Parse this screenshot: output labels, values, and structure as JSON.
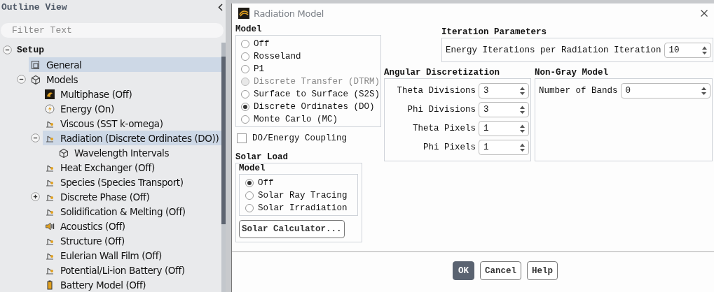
{
  "outline": {
    "title": "Outline View",
    "filter": {
      "placeholder": "Filter Text"
    },
    "tree": [
      {
        "label": "Setup",
        "bold": true,
        "expanded": true,
        "selected": false,
        "children": [
          {
            "label": "General",
            "selected": true
          },
          {
            "label": "Models",
            "expanded": true,
            "selected": false,
            "children": [
              {
                "label": "Multiphase (Off)",
                "selected": false
              },
              {
                "label": "Energy (On)",
                "selected": false
              },
              {
                "label": "Viscous (SST k-omega)",
                "selected": false
              },
              {
                "label": "Radiation (Discrete Ordinates (DO))",
                "expanded": true,
                "selected": true,
                "children": [
                  {
                    "label": "Wavelength Intervals",
                    "selected": false
                  }
                ]
              },
              {
                "label": "Heat Exchanger (Off)",
                "selected": false
              },
              {
                "label": "Species (Species Transport)",
                "selected": false
              },
              {
                "label": "Discrete Phase (Off)",
                "expanded": false,
                "selected": false
              },
              {
                "label": "Solidification & Melting (Off)",
                "selected": false
              },
              {
                "label": "Acoustics (Off)",
                "selected": false
              },
              {
                "label": "Structure (Off)",
                "selected": false
              },
              {
                "label": "Eulerian Wall Film (Off)",
                "selected": false
              },
              {
                "label": "Potential/Li-ion Battery (Off)",
                "selected": false
              },
              {
                "label": "Battery Model (Off)",
                "selected": false
              }
            ]
          }
        ]
      }
    ]
  },
  "dialog": {
    "title": "Radiation Model",
    "model": {
      "title": "Model",
      "options": [
        {
          "label": "Off",
          "selected": false,
          "disabled": false
        },
        {
          "label": "Rosseland",
          "selected": false,
          "disabled": false
        },
        {
          "label": "P1",
          "selected": false,
          "disabled": false
        },
        {
          "label": "Discrete Transfer (DTRM)",
          "selected": false,
          "disabled": true
        },
        {
          "label": "Surface to Surface (S2S)",
          "selected": false,
          "disabled": false
        },
        {
          "label": "Discrete Ordinates (DO)",
          "selected": true,
          "disabled": false
        },
        {
          "label": "Monte Carlo (MC)",
          "selected": false,
          "disabled": false
        }
      ]
    },
    "coupling": {
      "label": "DO/Energy Coupling",
      "checked": false
    },
    "iteration": {
      "title": "Iteration Parameters",
      "fields": [
        {
          "label": "Energy Iterations per Radiation Iteration",
          "value": "10"
        }
      ]
    },
    "angular": {
      "title": "Angular Discretization",
      "fields": [
        {
          "label": "Theta Divisions",
          "value": "3"
        },
        {
          "label": "Phi Divisions",
          "value": "3"
        },
        {
          "label": "Theta Pixels",
          "value": "1"
        },
        {
          "label": "Phi Pixels",
          "value": "1"
        }
      ]
    },
    "nongray": {
      "title": "Non-Gray Model",
      "fields": [
        {
          "label": "Number of Bands",
          "value": "0"
        }
      ]
    },
    "solar": {
      "title": "Solar Load",
      "model_title": "Model",
      "options": [
        {
          "label": "Off",
          "selected": true,
          "disabled": false
        },
        {
          "label": "Solar Ray Tracing",
          "selected": false,
          "disabled": false
        },
        {
          "label": "Solar Irradiation",
          "selected": false,
          "disabled": false
        }
      ],
      "calculator": "Solar Calculator..."
    },
    "buttons": [
      {
        "label": "OK",
        "primary": true
      },
      {
        "label": "Cancel",
        "primary": false
      },
      {
        "label": "Help",
        "primary": false
      }
    ]
  }
}
